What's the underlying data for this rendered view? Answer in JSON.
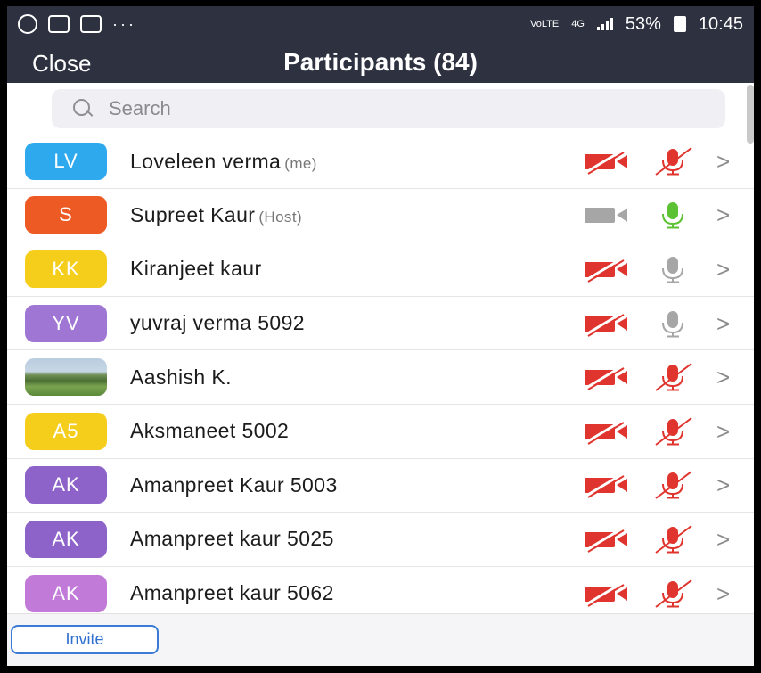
{
  "status_bar": {
    "dots": "···",
    "network_type": "VoLTE",
    "network_gen": "4G",
    "battery_percent": "53%",
    "time": "10:45"
  },
  "header": {
    "close_label": "Close",
    "title": "Participants (84)"
  },
  "search": {
    "placeholder": "Search"
  },
  "participants": [
    {
      "initials": "LV",
      "name": "Loveleen verma",
      "tag": "(me)",
      "avatar_color": "#2fa9ee",
      "video_on": false,
      "audio": "muted",
      "photo": false
    },
    {
      "initials": "S",
      "name": "Supreet Kaur",
      "tag": "(Host)",
      "avatar_color": "#ee5a24",
      "video_on": true,
      "audio": "active",
      "photo": false
    },
    {
      "initials": "KK",
      "name": "Kiranjeet kaur",
      "tag": "",
      "avatar_color": "#f5ce1c",
      "video_on": false,
      "audio": "idle",
      "photo": false
    },
    {
      "initials": "YV",
      "name": "yuvraj verma 5092",
      "tag": "",
      "avatar_color": "#9f76d3",
      "video_on": false,
      "audio": "idle",
      "photo": false
    },
    {
      "initials": "",
      "name": "Aashish K.",
      "tag": "",
      "avatar_color": "#5a8a3a",
      "video_on": false,
      "audio": "muted",
      "photo": true
    },
    {
      "initials": "A5",
      "name": "Aksmaneet 5002",
      "tag": "",
      "avatar_color": "#f5ce1c",
      "video_on": false,
      "audio": "muted",
      "photo": false
    },
    {
      "initials": "AK",
      "name": "Amanpreet Kaur 5003",
      "tag": "",
      "avatar_color": "#8e63c9",
      "video_on": false,
      "audio": "muted",
      "photo": false
    },
    {
      "initials": "AK",
      "name": "Amanpreet kaur 5025",
      "tag": "",
      "avatar_color": "#8e63c9",
      "video_on": false,
      "audio": "muted",
      "photo": false
    },
    {
      "initials": "AK",
      "name": "Amanpreet kaur 5062",
      "tag": "",
      "avatar_color": "#c17ad8",
      "video_on": false,
      "audio": "muted",
      "photo": false
    }
  ],
  "footer": {
    "invite_label": "Invite"
  },
  "colors": {
    "header_bg": "#2d3140",
    "muted_red": "#e0342e",
    "active_green": "#5cc234",
    "idle_gray": "#a6a6a6",
    "accent_blue": "#3a7bd5"
  },
  "icons": {
    "video": "video-camera-icon",
    "video_off": "video-camera-off-icon",
    "mic": "microphone-icon",
    "mic_off": "microphone-muted-icon",
    "row_chevron": "chevron-right-icon",
    "search": "search-icon"
  }
}
